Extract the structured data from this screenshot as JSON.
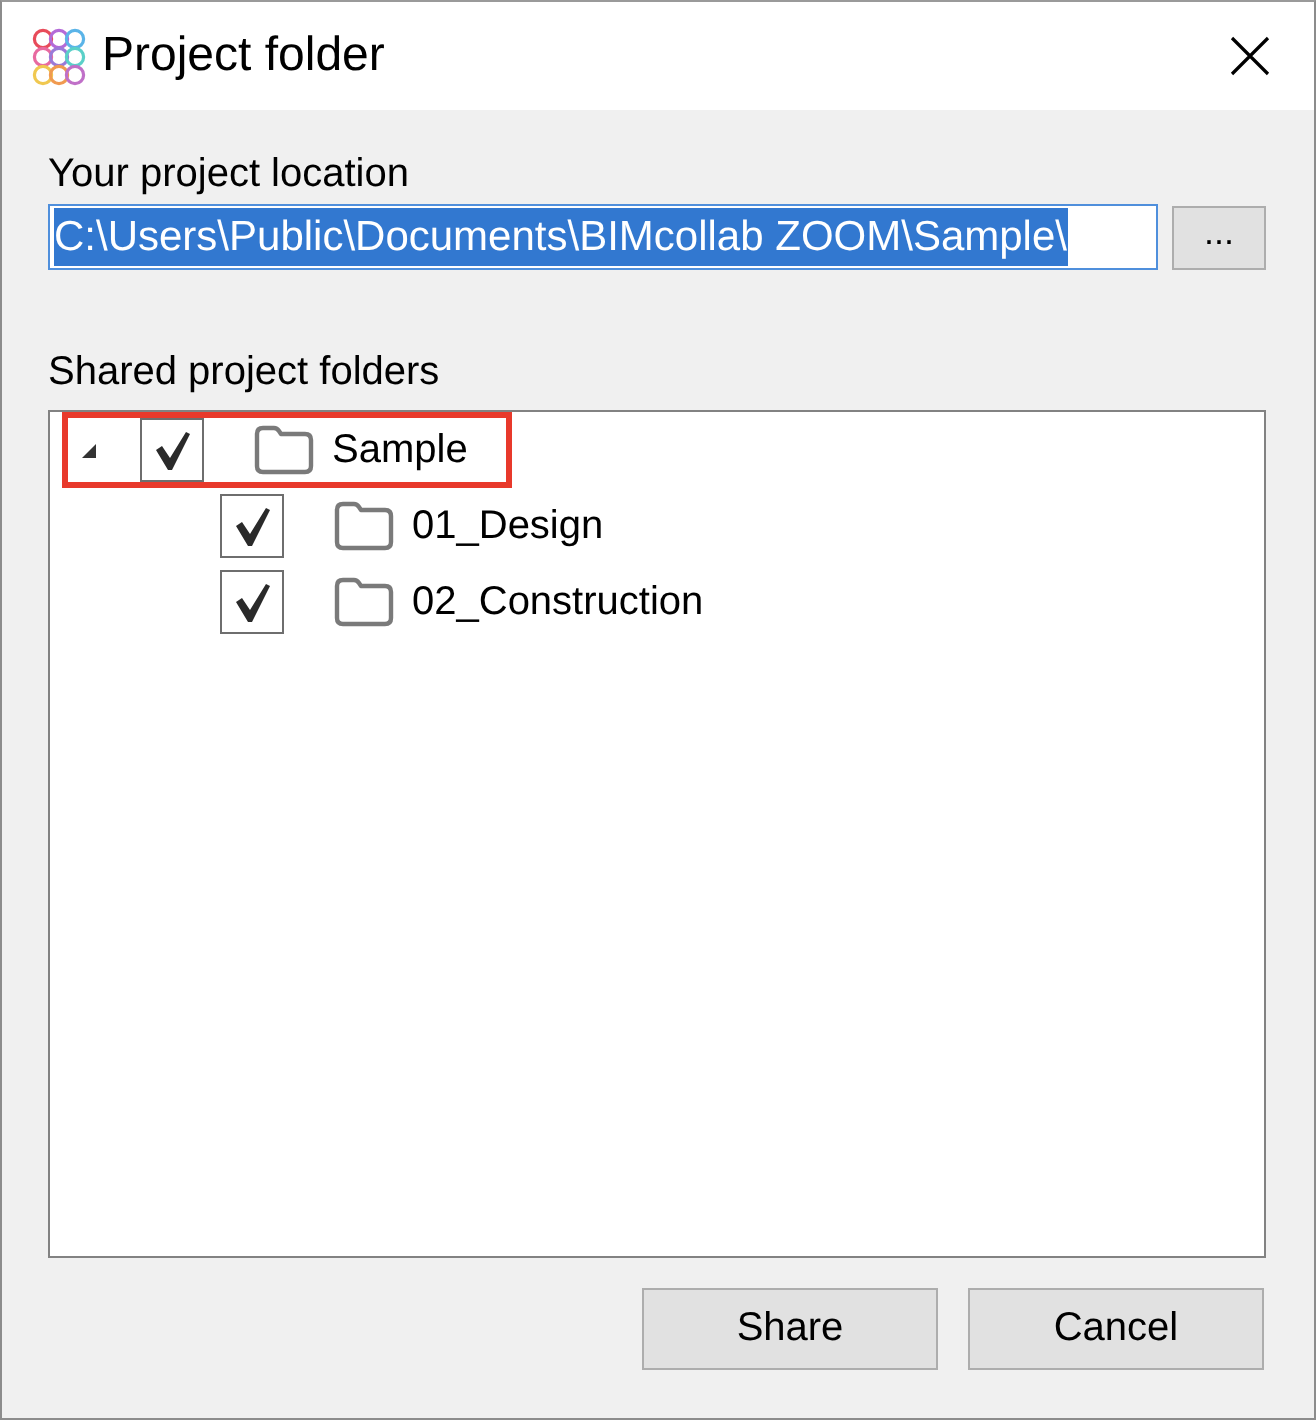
{
  "window": {
    "title": "Project folder"
  },
  "project_location": {
    "label": "Your project location",
    "value": "C:\\Users\\Public\\Documents\\BIMcollab ZOOM\\Sample\\",
    "text_selected": true,
    "browse_button": "..."
  },
  "shared_folders": {
    "label": "Shared project folders",
    "tree": [
      {
        "name": "Sample",
        "checked": true,
        "expanded": true,
        "highlighted": true,
        "children": [
          {
            "name": "01_Design",
            "checked": true
          },
          {
            "name": "02_Construction",
            "checked": true
          }
        ]
      }
    ]
  },
  "buttons": [
    {
      "label": "Share"
    },
    {
      "label": "Cancel"
    }
  ]
}
